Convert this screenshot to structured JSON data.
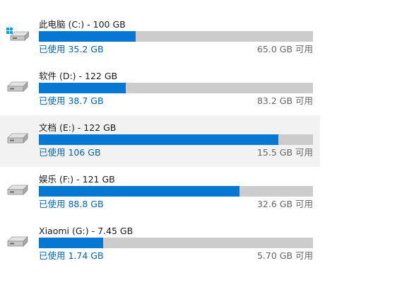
{
  "drives": [
    {
      "title": "此电脑 (C:) - 100 GB",
      "used": "已使用 35.2 GB",
      "free": "65.0 GB 可用",
      "used_fraction": 0.352,
      "icon": "system-drive-icon",
      "selected": false
    },
    {
      "title": "软件 (D:) - 122 GB",
      "used": "已使用 38.7 GB",
      "free": "83.2 GB 可用",
      "used_fraction": 0.317,
      "icon": "drive-icon",
      "selected": false
    },
    {
      "title": "文档 (E:) - 122 GB",
      "used": "已使用 106 GB",
      "free": "15.5 GB 可用",
      "used_fraction": 0.873,
      "icon": "drive-icon",
      "selected": true
    },
    {
      "title": "娱乐 (F:) - 121 GB",
      "used": "已使用 88.8 GB",
      "free": "32.6 GB 可用",
      "used_fraction": 0.731,
      "icon": "drive-icon",
      "selected": false
    },
    {
      "title": "Xiaomi (G:) - 7.45 GB",
      "used": "已使用 1.74 GB",
      "free": "5.70 GB 可用",
      "used_fraction": 0.234,
      "icon": "drive-icon",
      "selected": false
    }
  ],
  "colors": {
    "bar_fill": "#0678d4",
    "bar_track": "#cccccc",
    "used_text": "#0063b1",
    "selected_bg": "#f2f2f2",
    "windows_logo": "#00a4ef"
  }
}
